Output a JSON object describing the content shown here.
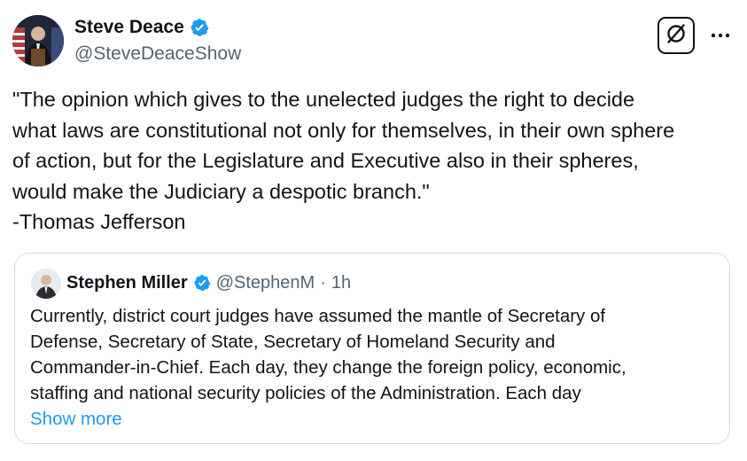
{
  "tweet": {
    "author": {
      "name": "Steve Deace",
      "handle": "@SteveDeaceShow",
      "verified": true,
      "avatar_icon": "author-avatar"
    },
    "actions": {
      "grok_icon": "grok-icon",
      "more_icon": "more-dots-icon"
    },
    "text": "\"The opinion which gives to the unelected judges the right to decide\nwhat laws are constitutional not only for themselves, in their own sphere\nof action, but for the Legislature and Executive also in their spheres,\nwould make the Judiciary a despotic branch.\"\n-Thomas Jefferson",
    "quote": {
      "author_name": "Stephen Miller",
      "verified": true,
      "handle": "@StephenM",
      "separator": "·",
      "time": "1h",
      "text": "Currently, district court judges have assumed the mantle of Secretary of\nDefense, Secretary of State, Secretary of Homeland Security and\nCommander-in-Chief. Each day, they change the foreign policy, economic,\nstaffing and national security policies of the Administration. Each day",
      "show_more_label": "Show more"
    }
  },
  "colors": {
    "verified_blue": "#1d9bf0",
    "link_blue": "#1d9bf0",
    "secondary_text": "#536471",
    "border": "#cfd9de"
  }
}
